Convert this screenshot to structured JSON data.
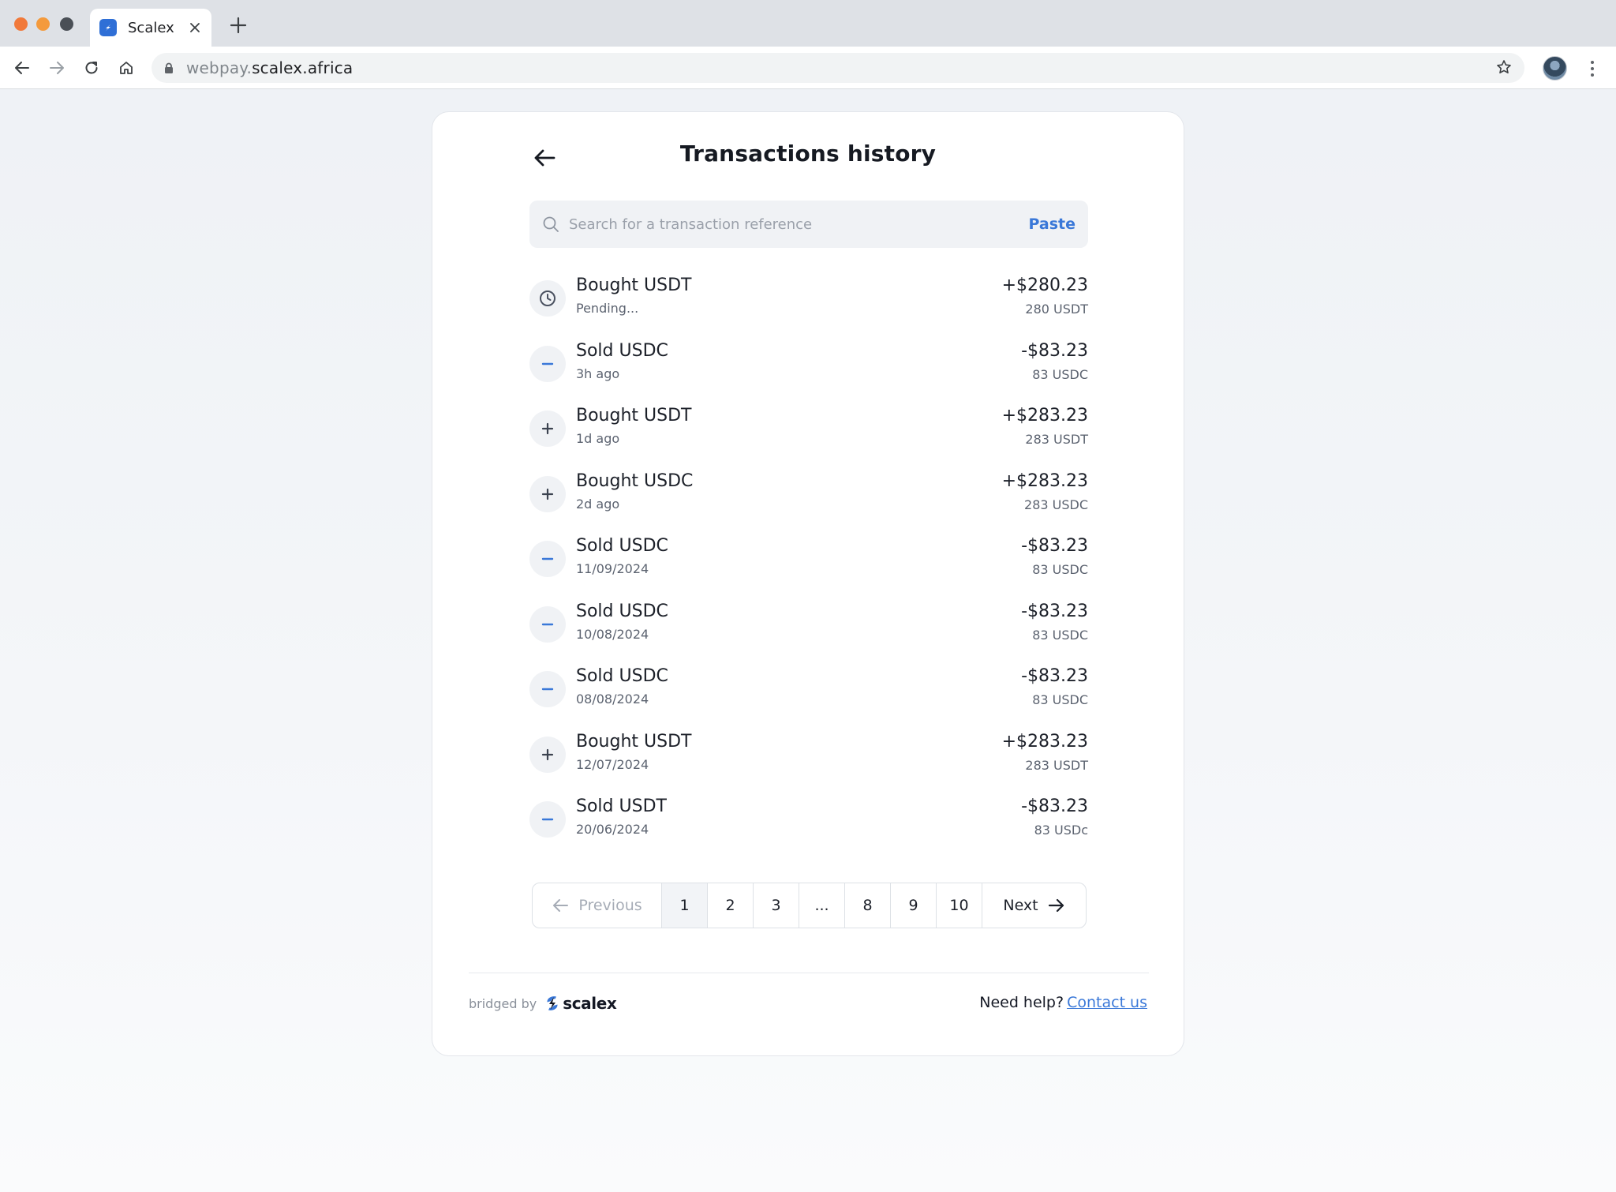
{
  "browser": {
    "tab_title": "Scalex",
    "url_subdomain": "webpay.",
    "url_host": "scalex.africa"
  },
  "page": {
    "title": "Transactions history"
  },
  "search": {
    "placeholder": "Search for a transaction reference",
    "paste_label": "Paste"
  },
  "transactions": [
    {
      "icon": "clock-icon",
      "title": "Bought USDT",
      "subtitle": "Pending...",
      "amount": "+$280.23",
      "crypto": "280 USDT"
    },
    {
      "icon": "minus-icon",
      "title": "Sold USDC",
      "subtitle": "3h ago",
      "amount": "-$83.23",
      "crypto": "83 USDC"
    },
    {
      "icon": "plus-icon",
      "title": "Bought USDT",
      "subtitle": "1d ago",
      "amount": "+$283.23",
      "crypto": "283 USDT"
    },
    {
      "icon": "plus-icon",
      "title": "Bought USDC",
      "subtitle": "2d ago",
      "amount": "+$283.23",
      "crypto": "283 USDC"
    },
    {
      "icon": "minus-icon",
      "title": "Sold USDC",
      "subtitle": "11/09/2024",
      "amount": "-$83.23",
      "crypto": "83 USDC"
    },
    {
      "icon": "minus-icon",
      "title": "Sold USDC",
      "subtitle": "10/08/2024",
      "amount": "-$83.23",
      "crypto": "83 USDC"
    },
    {
      "icon": "minus-icon",
      "title": "Sold USDC",
      "subtitle": "08/08/2024",
      "amount": "-$83.23",
      "crypto": "83 USDC"
    },
    {
      "icon": "plus-icon",
      "title": "Bought USDT",
      "subtitle": "12/07/2024",
      "amount": "+$283.23",
      "crypto": "283 USDT"
    },
    {
      "icon": "minus-icon",
      "title": "Sold USDT",
      "subtitle": "20/06/2024",
      "amount": "-$83.23",
      "crypto": "83 USDc"
    }
  ],
  "pagination": {
    "previous_label": "Previous",
    "next_label": "Next",
    "pages": [
      "1",
      "2",
      "3",
      "...",
      "8",
      "9",
      "10"
    ],
    "current": "1"
  },
  "footer": {
    "bridged_by": "bridged by",
    "brand_name": "scalex",
    "help_text": "Need help?",
    "contact_label": "Contact us"
  },
  "colors": {
    "accent": "#3a78d8",
    "minus_icon": "#3a78d8",
    "plus_icon": "#3c4350"
  }
}
